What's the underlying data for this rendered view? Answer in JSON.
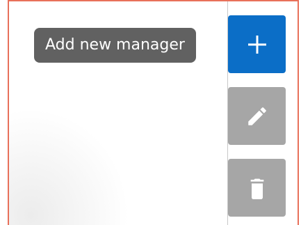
{
  "tooltip": {
    "text": "Add new manager"
  },
  "toolbar": {
    "add": {
      "icon": "plus-icon",
      "state": "enabled"
    },
    "edit": {
      "icon": "pencil-icon",
      "state": "disabled"
    },
    "delete": {
      "icon": "trash-icon",
      "state": "disabled"
    }
  },
  "colors": {
    "primary": "#0b6ec7",
    "disabled": "#a6a6a6",
    "tooltip_bg": "#616161",
    "frame_border": "#e8705a"
  }
}
